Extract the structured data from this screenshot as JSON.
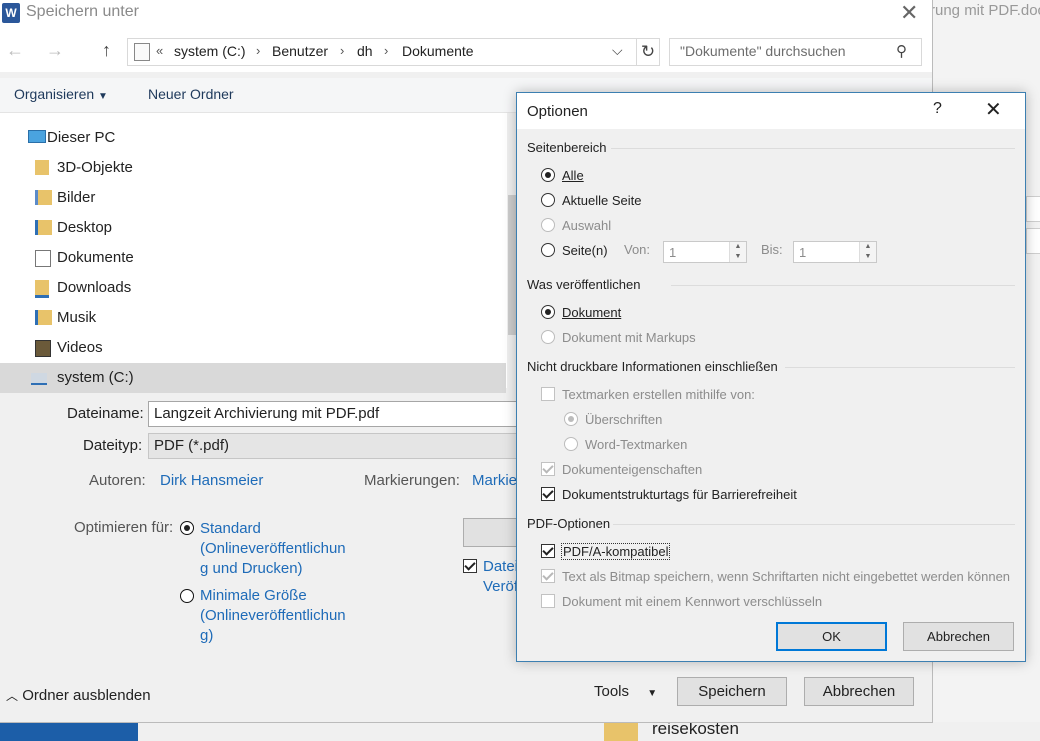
{
  "background_window": {
    "title_fragment": "rung mit PDF.doc",
    "file_item": "reisekosten"
  },
  "save_dialog": {
    "title": "Speichern unter",
    "close_glyph": "✕",
    "nav": {
      "back": "←",
      "forward": "→",
      "up": "↑"
    },
    "address": {
      "overflow": "«",
      "segments": [
        "system (C:)",
        "Benutzer",
        "dh",
        "Dokumente"
      ],
      "separator": "›",
      "dropdown": "⌵",
      "refresh": "↻"
    },
    "search_placeholder": "\"Dokumente\" durchsuchen",
    "toolbar": {
      "organize": "Organisieren",
      "new_folder": "Neuer Ordner"
    },
    "tree": [
      {
        "label": "Dieser PC",
        "icon": "pc-icon"
      },
      {
        "label": "3D-Objekte",
        "icon": "folder-icon"
      },
      {
        "label": "Bilder",
        "icon": "pictures-folder-icon"
      },
      {
        "label": "Desktop",
        "icon": "desktop-folder-icon"
      },
      {
        "label": "Dokumente",
        "icon": "documents-folder-icon"
      },
      {
        "label": "Downloads",
        "icon": "downloads-folder-icon"
      },
      {
        "label": "Musik",
        "icon": "music-folder-icon"
      },
      {
        "label": "Videos",
        "icon": "videos-folder-icon"
      },
      {
        "label": "system (C:)",
        "icon": "drive-icon"
      }
    ],
    "filename_label": "Dateiname:",
    "filename_value": "Langzeit Archivierung mit PDF.pdf",
    "filetype_label": "Dateityp:",
    "filetype_value": "PDF (*.pdf)",
    "authors_label": "Autoren:",
    "authors_value": "Dirk Hansmeier",
    "tags_label": "Markierungen:",
    "tags_value": "Markie",
    "optimize_label": "Optimieren für:",
    "optimize_standard": [
      "Standard",
      "(Onlineveröffentlichun",
      "g und Drucken)"
    ],
    "optimize_minimal": [
      "Minimale Größe",
      "(Onlineveröffentlichun",
      "g)"
    ],
    "open_after_partial": [
      "Datei",
      "Veröf"
    ],
    "hide_folders": "Ordner ausblenden",
    "tools": "Tools",
    "save": "Speichern",
    "cancel": "Abbrechen"
  },
  "options_dialog": {
    "title": "Optionen",
    "help": "?",
    "close": "✕",
    "page_range": {
      "heading": "Seitenbereich",
      "all": "Alle",
      "current": "Aktuelle Seite",
      "selection": "Auswahl",
      "pages": "Seite(n)",
      "from_label": "Von:",
      "from_value": "1",
      "to_label": "Bis:",
      "to_value": "1"
    },
    "publish": {
      "heading": "Was veröffentlichen",
      "document": "Dokument",
      "document_markup": "Dokument mit Markups"
    },
    "nonprint": {
      "heading": "Nicht druckbare Informationen einschließen",
      "bookmarks": "Textmarken erstellen mithilfe von:",
      "headings": "Überschriften",
      "word_bookmarks": "Word-Textmarken",
      "doc_props": "Dokumenteigenschaften",
      "struct_tags": "Dokumentstrukturtags für Barrierefreiheit"
    },
    "pdf": {
      "heading": "PDF-Optionen",
      "pdfa": "PDF/A-kompatibel",
      "bitmap": "Text als Bitmap speichern, wenn Schriftarten nicht eingebettet werden können",
      "encrypt": "Dokument mit einem Kennwort verschlüsseln"
    },
    "ok": "OK",
    "cancel": "Abbrechen"
  }
}
